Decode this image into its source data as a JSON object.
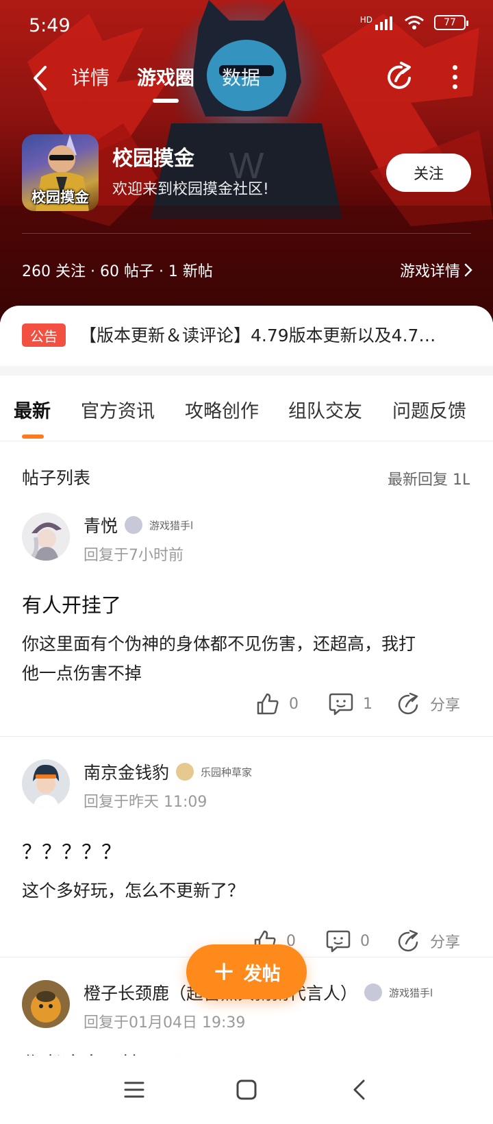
{
  "status_bar": {
    "time": "5:49",
    "network_label": "HD",
    "battery": "77"
  },
  "top_nav": {
    "tabs": [
      {
        "label": "详情"
      },
      {
        "label": "游戏圈"
      },
      {
        "label": "数据"
      }
    ],
    "active_tab_index": 1
  },
  "game": {
    "icon_label": "校园摸金",
    "name": "校园摸金",
    "welcome": "欢迎来到校园摸金社区!",
    "follow_label": "关注",
    "stats": "260 关注 · 60 帖子 · 1 新帖",
    "detail_link": "游戏详情"
  },
  "notice": {
    "tag": "公告",
    "text": "【版本更新＆读评论】4.79版本更新以及4.7…"
  },
  "categories": [
    {
      "label": "最新"
    },
    {
      "label": "官方资讯"
    },
    {
      "label": "攻略创作"
    },
    {
      "label": "组队交友"
    },
    {
      "label": "问题反馈"
    }
  ],
  "post_list": {
    "title": "帖子列表",
    "sort_label": "最新回复 1L"
  },
  "posts": [
    {
      "author": "青悦",
      "badge": "游戏猎手l",
      "reply_time": "回复于7小时前",
      "title": "有人开挂了",
      "body_lines": [
        "你这里面有个伪神的身体都不见伤害，还超高，我打",
        "他一点伤害不掉"
      ],
      "likes": "0",
      "comments": "1",
      "share_label": "分享"
    },
    {
      "author": "南京金钱豹",
      "badge": "乐园种草家",
      "reply_time": "回复于昨天 11:09",
      "title": "？？？？？",
      "body_lines": [
        "这个多好玩，怎么不更新了？"
      ],
      "likes": "0",
      "comments": "0",
      "share_label": "分享"
    },
    {
      "author": "橙子长颈鹿（超营黑兵粥粥代言人）",
      "badge": "游戏猎手l",
      "reply_time": "回复于01月04日 19:39",
      "title": "作者这人开挂了吗"
    }
  ],
  "fab": {
    "label": "发帖"
  },
  "colors": {
    "accent": "#ff8a1c",
    "hero_red": "#8e1310",
    "notice_tag": "#f25041"
  }
}
